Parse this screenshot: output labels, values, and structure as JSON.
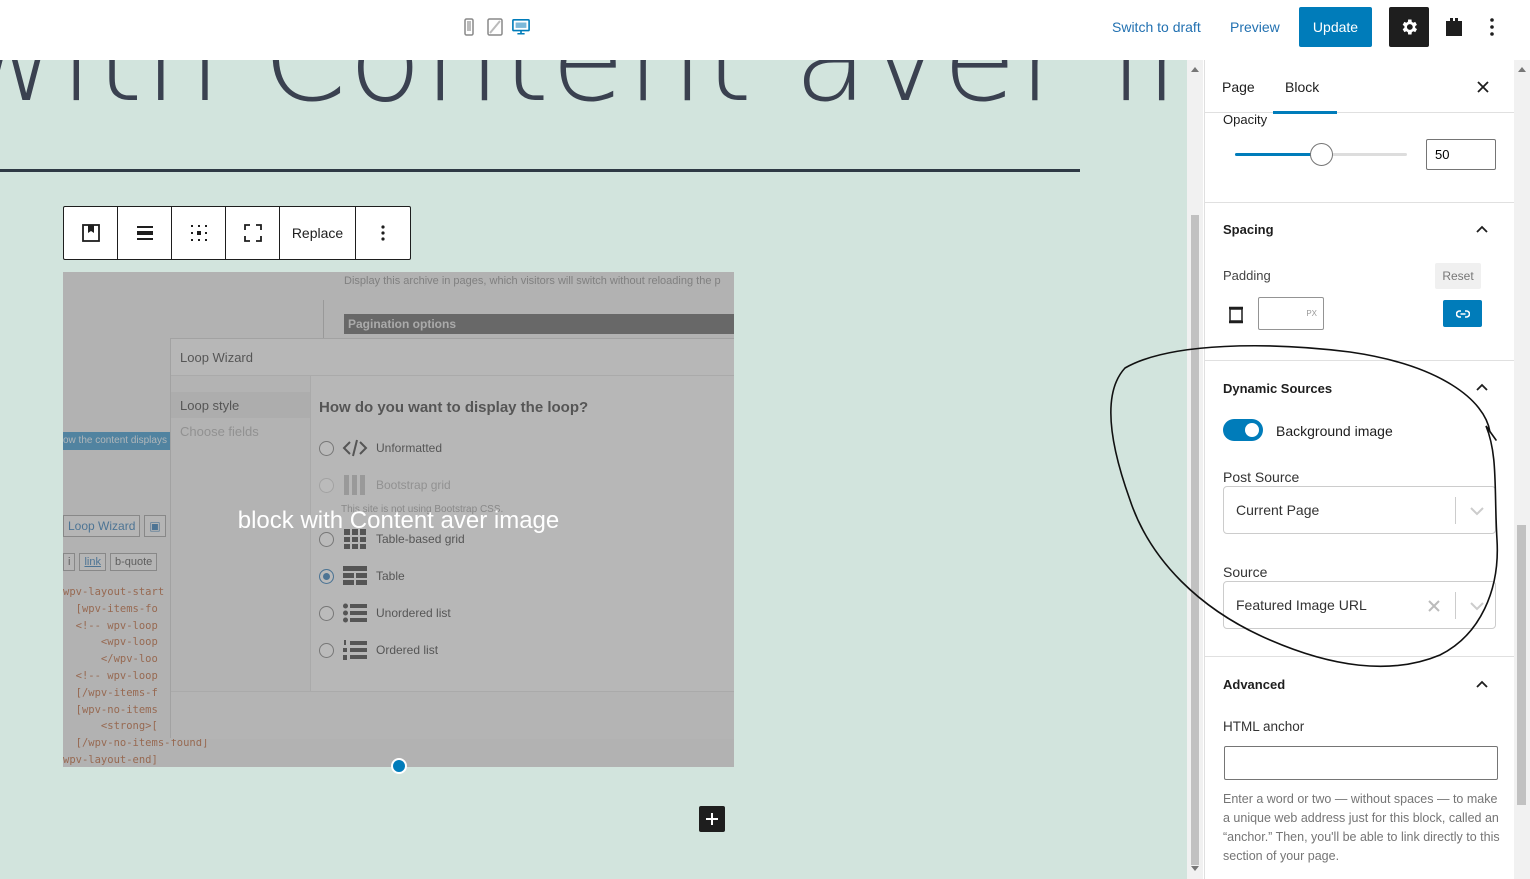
{
  "topbar": {
    "switch_to_draft": "Switch to draft",
    "preview": "Preview",
    "update": "Update",
    "accent": "#007cba"
  },
  "canvas": {
    "title_fragment": "with Content aver image",
    "toolbar": {
      "replace": "Replace"
    },
    "cover_text": "block with Content aver image",
    "background_screenshot": {
      "top_text": "Display this archive in pages, which visitors will switch without reloading the p",
      "pagination_header": "Pagination options",
      "dialog_title": "Loop Wizard",
      "side_items": [
        "Loop style",
        "Choose fields"
      ],
      "question": "How do you want to display the loop?",
      "options": [
        {
          "label": "Unformatted"
        },
        {
          "label": "Bootstrap grid"
        },
        {
          "label": "Table-based grid"
        },
        {
          "label": "Table"
        },
        {
          "label": "Unordered list"
        },
        {
          "label": "Ordered list"
        }
      ],
      "bootstrap_note": "This site is not using Bootstrap CSS.",
      "blue_strip": "ow the content displays",
      "buttons": [
        "Loop Wizard"
      ],
      "buttons2": [
        "i",
        "link",
        "b-quote"
      ],
      "code_lines": [
        "wpv-layout-start",
        "  [wpv-items-fo",
        "  <!-- wpv-loop",
        "      <wpv-loop",
        "      </wpv-loo",
        "  <!-- wpv-loop",
        "  [/wpv-items-f",
        "  [wpv-no-items",
        "      <strong>[",
        "  [/wpv-no-items-found]",
        "wpv-layout-end]"
      ]
    }
  },
  "sidebar": {
    "tabs": {
      "page": "Page",
      "block": "Block"
    },
    "opacity": {
      "label": "Opacity",
      "value": "50",
      "fraction": 0.5
    },
    "spacing": {
      "title": "Spacing",
      "padding_label": "Padding",
      "reset": "Reset",
      "unit": "PX"
    },
    "dynamic_sources": {
      "title": "Dynamic Sources",
      "toggle_label": "Background image",
      "post_source_label": "Post Source",
      "post_source_value": "Current Page",
      "source_label": "Source",
      "source_value": "Featured Image URL"
    },
    "advanced": {
      "title": "Advanced",
      "anchor_label": "HTML anchor",
      "help": "Enter a word or two — without spaces — to make a unique web address just for this block, called an “anchor.” Then, you'll be able to link directly to this section of your page."
    }
  }
}
